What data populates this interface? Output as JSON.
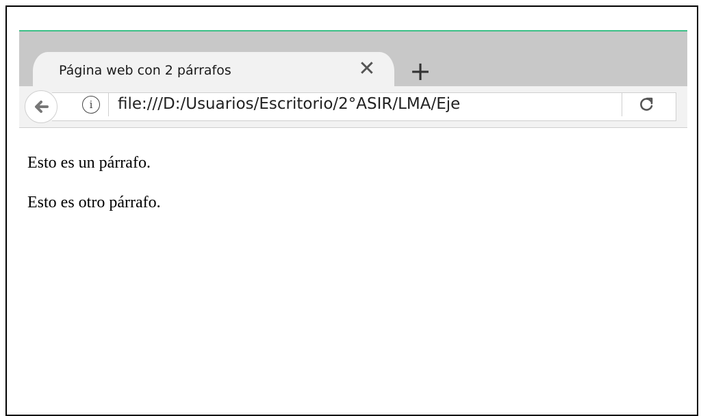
{
  "tab": {
    "title": "Página web con 2 párrafos",
    "close_icon": "close-icon",
    "close_glyph": "✕",
    "newtab_glyph": "+"
  },
  "navbar": {
    "back_icon": "back-arrow-icon",
    "info_icon": "info-icon",
    "info_glyph": "i",
    "url": "file:///D:/Usuarios/Escritorio/2°ASIR/LMA/Eje",
    "reload_icon": "reload-icon"
  },
  "page": {
    "paragraphs": [
      "Esto es un párrafo.",
      "Esto es otro párrafo."
    ]
  },
  "colors": {
    "accent": "#3cbf86",
    "tabstrip": "#c8c8c8",
    "toolbar": "#f2f2f2"
  }
}
